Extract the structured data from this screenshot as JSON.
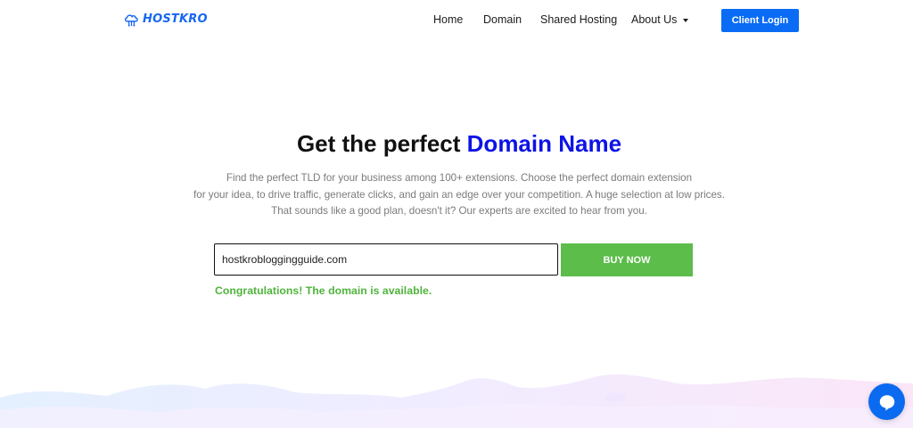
{
  "brand": {
    "name": "HOSTKRO",
    "color": "#1767f2"
  },
  "nav": {
    "items": [
      {
        "label": "Home"
      },
      {
        "label": "Domain"
      },
      {
        "label": "Shared Hosting"
      },
      {
        "label": "About Us"
      }
    ],
    "client_login": "Client Login"
  },
  "hero": {
    "title_prefix": "Get the perfect ",
    "title_highlight": "Domain Name",
    "description_lines": [
      "Find the perfect TLD for your business among 100+ extensions. Choose the perfect domain extension",
      "for your idea, to drive traffic, generate clicks, and gain an edge over your competition. A huge selection at low prices.",
      "That sounds like a good plan, doesn't it? Our experts are excited to hear from you."
    ]
  },
  "search": {
    "value": "hostkrobloggingguide.com",
    "button_label": "BUY NOW",
    "status": "Congratulations! The domain is available."
  },
  "colors": {
    "accent": "#0a6cf5",
    "highlight": "#0d13e6",
    "success": "#5cbd4a",
    "text_muted": "#7b7b7b"
  },
  "icons": {
    "logo": "cloud-logo-icon",
    "nav_dropdown": "caret-down-icon",
    "chat": "chat-bubble-icon"
  }
}
